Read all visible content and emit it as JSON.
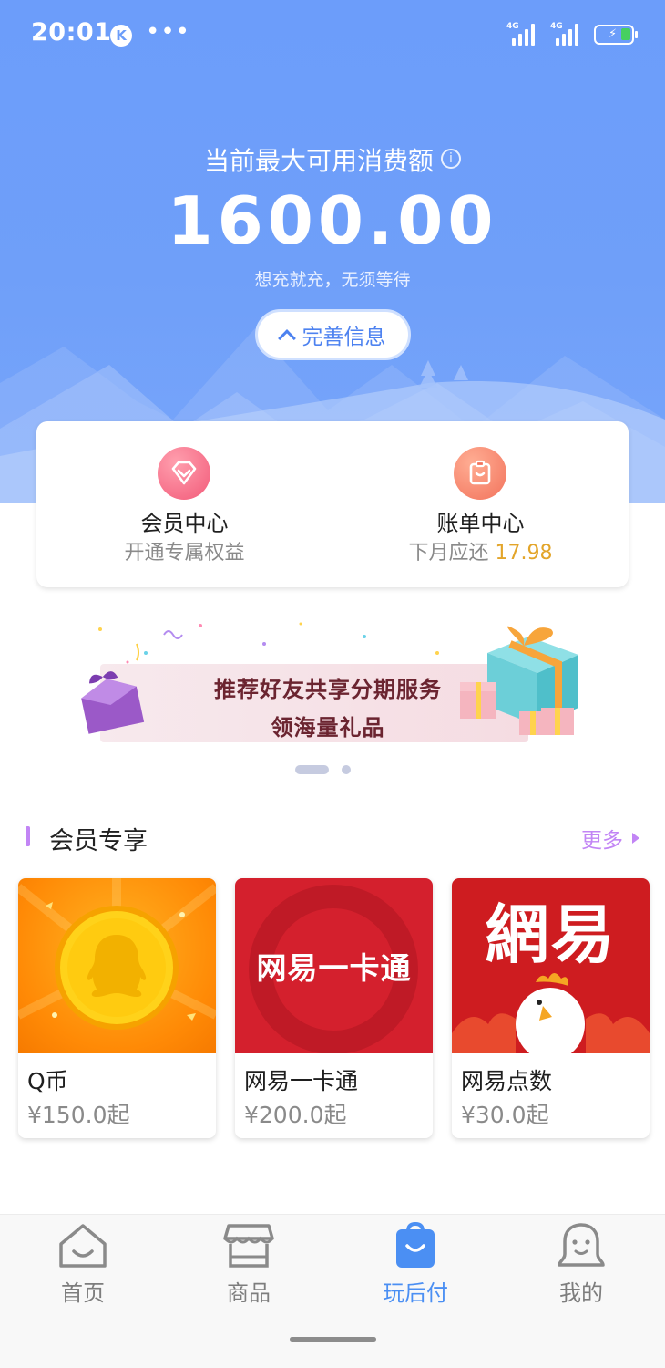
{
  "status_bar": {
    "time": "20:01",
    "app_badge": "K",
    "dots": "•••",
    "network1": "4G",
    "network2": "4G"
  },
  "hero": {
    "title": "当前最大可用消费额",
    "info_glyph": "i",
    "amount": "1600.00",
    "subtitle": "想充就充，无须等待",
    "complete_button": "完善信息"
  },
  "cards": {
    "vip": {
      "title": "会员中心",
      "sub": "开通专属权益"
    },
    "bill": {
      "title": "账单中心",
      "sub_prefix": "下月应还",
      "amount": "17.98"
    }
  },
  "banner": {
    "line1": "推荐好友共享分期服务",
    "line2": "领海量礼品"
  },
  "carousel": {
    "pages": 2,
    "active_index": 0
  },
  "section": {
    "title": "会员专享",
    "more": "更多"
  },
  "products": [
    {
      "name": "Q币",
      "price": "¥150.0起",
      "icon": "qq-coin"
    },
    {
      "name": "网易一卡通",
      "price": "¥200.0起",
      "icon": "netease-card",
      "image_text": "网易一卡通"
    },
    {
      "name": "网易点数",
      "price": "¥30.0起",
      "icon": "netease-points",
      "image_text": "網易"
    }
  ],
  "tabs": [
    {
      "label": "首页",
      "icon": "home-icon",
      "active": false
    },
    {
      "label": "商品",
      "icon": "store-icon",
      "active": false
    },
    {
      "label": "玩后付",
      "icon": "bag-icon",
      "active": true
    },
    {
      "label": "我的",
      "icon": "profile-icon",
      "active": false
    }
  ],
  "colors": {
    "hero_blue": "#6c9dfa",
    "accent_purple": "#c285f5",
    "tab_active": "#4b8ff3",
    "amount_gold": "#e3a52a"
  }
}
